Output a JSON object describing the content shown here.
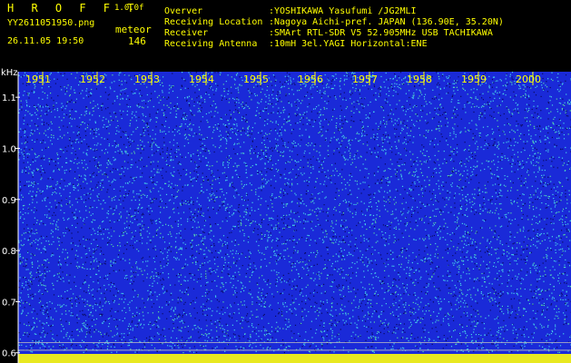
{
  "header": {
    "app_title": "H R O F F T",
    "version": "1.0.0f",
    "filename": "YY2611051950.png",
    "datetime": "26.11.05 19:50",
    "mode": "meteor",
    "count": "146"
  },
  "info": [
    {
      "label": "Overver",
      "value": ":YOSHIKAWA Yasufumi /JG2MLI"
    },
    {
      "label": "Receiving Location",
      "value": ":Nagoya Aichi-pref. JAPAN (136.90E, 35.20N)"
    },
    {
      "label": "Receiver",
      "value": ":SMArt RTL-SDR V5 52.905MHz USB TACHIKAWA"
    },
    {
      "label": "Receiving Antenna",
      "value": ":10mH 3el.YAGI Horizontal:ENE"
    }
  ],
  "colors": {
    "background": "#000000",
    "text": "#ffff00",
    "grid": "#ffffff",
    "noise_base": "#1a2ad8",
    "noise_bright": "#46d0e8"
  },
  "chart_data": {
    "type": "heatmap",
    "ylabel": "kHz",
    "y_ticks": [
      "1.1",
      "1.0",
      "0.9",
      "0.8",
      "0.7",
      "0.6"
    ],
    "y_tick_values": [
      1.1,
      1.0,
      0.9,
      0.8,
      0.7,
      0.6
    ],
    "ylim": [
      0.58,
      1.15
    ],
    "x_labels": [
      "1951",
      "1952",
      "1953",
      "1954",
      "1955",
      "1956",
      "1957",
      "1958",
      "1959",
      "2000"
    ],
    "x_label_minutes": [
      51,
      52,
      53,
      54,
      55,
      56,
      57,
      58,
      59,
      60
    ],
    "xlim": [
      50.55,
      60.7
    ],
    "reference_lines_khz": [
      0.62,
      0.605
    ],
    "description_of_values": "broadband noise"
  }
}
